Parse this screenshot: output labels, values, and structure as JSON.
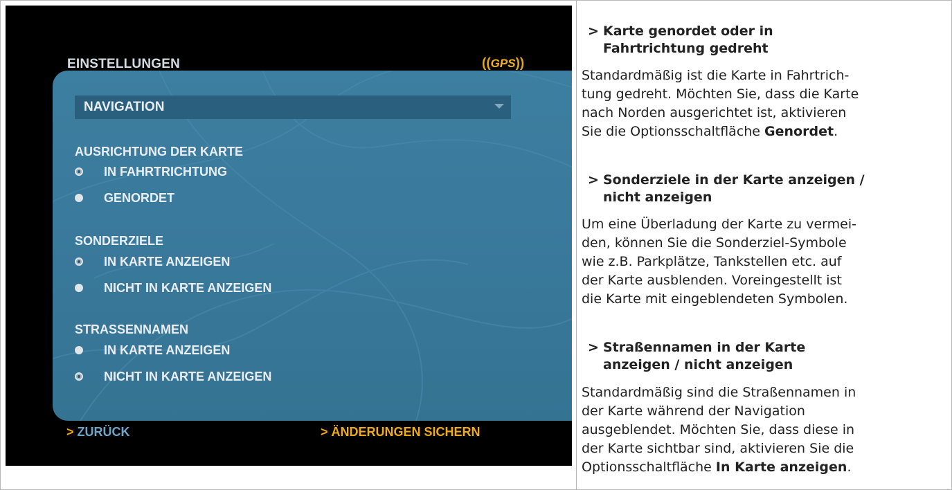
{
  "device": {
    "title": "EINSTELLUNGEN",
    "gps_open": "((",
    "gps_word": "GPS",
    "gps_close": "))",
    "dropdown_value": "NAVIGATION",
    "groups": [
      {
        "heading": "AUSRICHTUNG DER KARTE",
        "options": [
          {
            "label": "IN FAHRTRICHTUNG",
            "selected": true
          },
          {
            "label": "GENORDET",
            "selected": false
          }
        ]
      },
      {
        "heading": "SONDERZIELE",
        "options": [
          {
            "label": "IN KARTE ANZEIGEN",
            "selected": true
          },
          {
            "label": "NICHT IN KARTE ANZEIGEN",
            "selected": false
          }
        ]
      },
      {
        "heading": "STRASSENNAMEN",
        "options": [
          {
            "label": "IN KARTE ANZEIGEN",
            "selected": false
          },
          {
            "label": "NICHT IN KARTE ANZEIGEN",
            "selected": true
          }
        ]
      }
    ],
    "back_arrow": ">",
    "back_label": "ZURÜCK",
    "save_arrow": ">",
    "save_label": "ÄNDERUNGEN SICHERN",
    "colors": {
      "accent": "#f0a91a",
      "panel": "#3a7a9c",
      "dropdown": "#2a5f7d",
      "back_link": "#6fa4c8"
    }
  },
  "description": {
    "sections": [
      {
        "heading_line1": "Karte genordet oder in",
        "heading_line2": "Fahrtrichtung gedreht",
        "body_plain": "Standardmäßig ist die Karte in Fahrtrich-\ntung gedreht. Möchten Sie, dass die Karte\nnach Norden ausgerichtet ist, aktivieren\nSie die Optionsschaltfläche ",
        "body_bold": "Genordet",
        "body_end": "."
      },
      {
        "heading_line1": "Sonderziele in der Karte anzeigen /",
        "heading_line2": "nicht anzeigen",
        "body_plain": "Um eine Überladung der Karte zu vermei-\nden, können Sie die Sonderziel-Symbole\nwie z.B. Parkplätze, Tankstellen etc. auf\nder Karte ausblenden. Voreingestellt ist\ndie Karte mit eingeblendeten Symbolen.",
        "body_bold": "",
        "body_end": ""
      },
      {
        "heading_line1": "Straßennamen in der Karte",
        "heading_line2": "anzeigen / nicht anzeigen",
        "body_plain": "Standardmäßig sind die Straßennamen in\nder Karte während der Navigation\nausgeblendet. Möchten Sie, dass diese in\nder Karte sichtbar sind, aktivieren Sie die\nOptionsschaltfläche ",
        "body_bold": "In Karte anzeigen",
        "body_end": "."
      }
    ],
    "chevron": ">"
  }
}
